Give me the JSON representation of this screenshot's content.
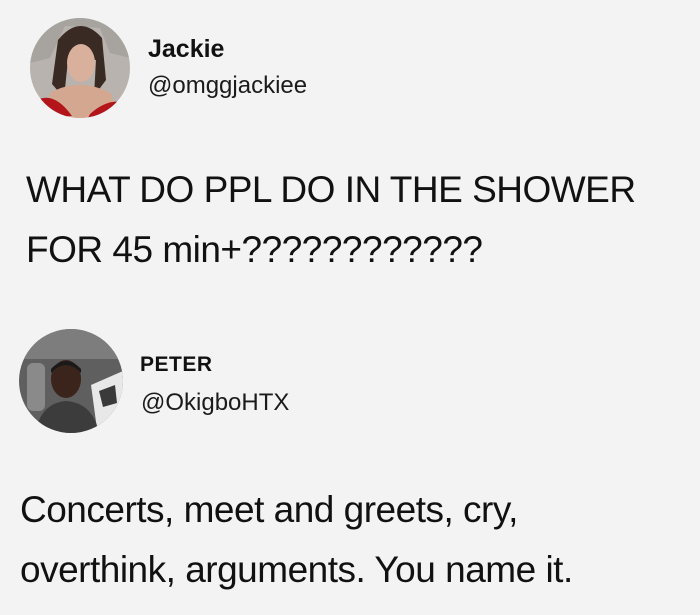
{
  "tweets": [
    {
      "display_name": "Jackie",
      "handle": "@omggjackiee",
      "text": "WHAT DO PPL DO IN THE SHOWER\nFOR 45 min+????????????",
      "avatar_icon": "profile-photo-icon"
    },
    {
      "display_name": "PETER",
      "handle": "@OkigboHTX",
      "text": "Concerts, meet and greets, cry,\noverthink, arguments. You name it.",
      "avatar_icon": "profile-photo-icon"
    }
  ],
  "colors": {
    "background": "#f3f3f3",
    "text": "#111111"
  }
}
